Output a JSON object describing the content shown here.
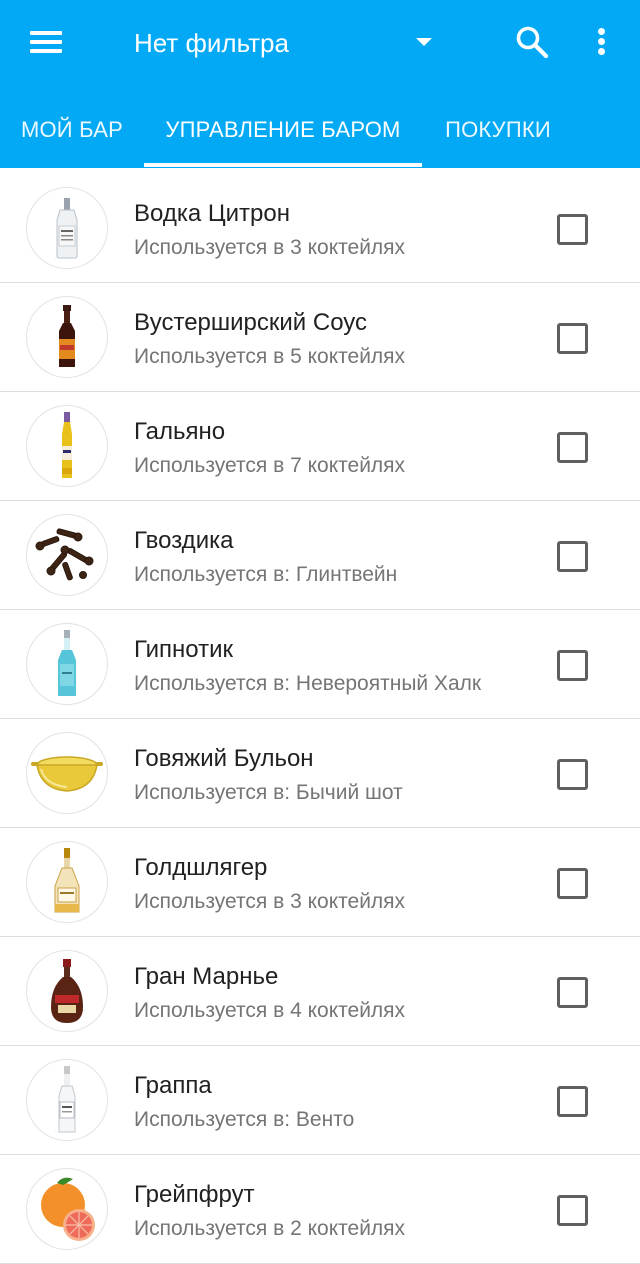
{
  "toolbar": {
    "menu_icon": "hamburger-menu-icon",
    "filter_label": "Нет фильтра",
    "dropdown_icon": "dropdown-arrow-icon",
    "search_icon": "search-icon",
    "more_icon": "more-vertical-icon"
  },
  "tabs": [
    {
      "label": "МОЙ БАР",
      "active": false
    },
    {
      "label": "УПРАВЛЕНИЕ БАРОМ",
      "active": true
    },
    {
      "label": "ПОКУПКИ",
      "active": false
    }
  ],
  "colors": {
    "appbar": "#03a9f4",
    "tab_indicator": "#ffffff",
    "title_text": "#212121",
    "subtitle_text": "#757575",
    "checkbox_border": "#5f5f5f"
  },
  "ingredients": [
    {
      "name": "Водка Цитрон",
      "usage": "Используется в 3 коктейлях",
      "image": "vodka-bottle",
      "checked": false
    },
    {
      "name": "Вустерширский Соус",
      "usage": "Используется в 5 коктейлях",
      "image": "sauce-bottle",
      "checked": false
    },
    {
      "name": "Гальяно",
      "usage": "Используется в 7 коктейлях",
      "image": "galliano-bottle",
      "checked": false
    },
    {
      "name": "Гвоздика",
      "usage": "Используется в: Глинтвейн",
      "image": "cloves",
      "checked": false
    },
    {
      "name": "Гипнотик",
      "usage": "Используется в: Невероятный Халк",
      "image": "hpnotiq-bottle",
      "checked": false
    },
    {
      "name": "Говяжий Бульон",
      "usage": "Используется в: Бычий шот",
      "image": "broth-bowl",
      "checked": false
    },
    {
      "name": "Голдшлягер",
      "usage": "Используется в 3 коктейлях",
      "image": "goldschlager-bottle",
      "checked": false
    },
    {
      "name": "Гран Марнье",
      "usage": "Используется в 4 коктейлях",
      "image": "grand-marnier-bottle",
      "checked": false
    },
    {
      "name": "Граппа",
      "usage": "Используется в: Венто",
      "image": "grappa-bottle",
      "checked": false
    },
    {
      "name": "Грейпфрут",
      "usage": "Используется в 2 коктейлях",
      "image": "grapefruit",
      "checked": false
    }
  ]
}
